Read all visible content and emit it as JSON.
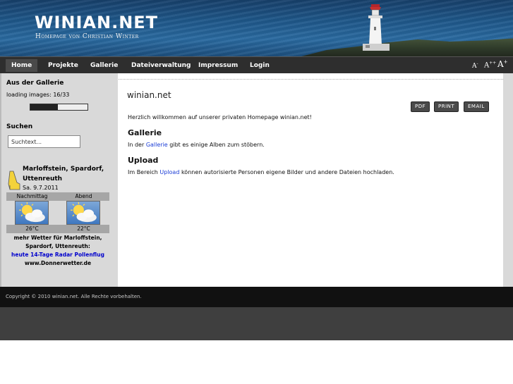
{
  "site": {
    "title": "WINIAN.NET",
    "subtitle": "Homepage von Christian Winter"
  },
  "nav": {
    "items": [
      "Home",
      "Projekte",
      "Gallerie",
      "Dateiverwaltung",
      "Impressum",
      "Login"
    ],
    "active": "Home",
    "font_size_controls": [
      "A-",
      "A+",
      "A+"
    ]
  },
  "sidebar": {
    "gallery": {
      "heading": "Aus der Gallerie",
      "loading_text": "loading images: 16/33",
      "progress": 0.48
    },
    "search": {
      "heading": "Suchen",
      "placeholder": "Suchtext..."
    },
    "weather": {
      "place": "Marloffstein, Spardorf, Uttenreuth",
      "date": "Sa. 9.7.2011",
      "periods": [
        "Nachmittag",
        "Abend"
      ],
      "temps": [
        "26°C",
        "22°C"
      ],
      "icon": "sun-cloud-icon",
      "more_line1": "mehr Wetter für Marloffstein,",
      "more_line2": "Spardorf, Uttenreuth:",
      "links": [
        "heute",
        "14-Tage",
        "Radar",
        "Pollenflug"
      ],
      "source": "www.Donnerwetter.de"
    }
  },
  "main": {
    "title": "winian.net",
    "buttons": [
      "PDF",
      "PRINT",
      "EMAIL"
    ],
    "intro": "Herzlich willkommen auf unserer privaten Homepage winian.net!",
    "sections": [
      {
        "heading": "Gallerie",
        "text_before": "In der ",
        "link": "Gallerie",
        "text_after": " gibt es einige Alben zum stöbern."
      },
      {
        "heading": "Upload",
        "text_before": "Im Bereich ",
        "link": "Upload",
        "text_after": " können autorisierte Personen eigene Bilder und andere Dateien hochladen."
      }
    ]
  },
  "footer": {
    "copyright": "Copyright © 2010 winian.net. Alle Rechte vorbehalten."
  },
  "colors": {
    "navbar": "#2e2e2e",
    "sidebar": "#d9d9d9",
    "link": "#1a3cd6",
    "footer": "#111111"
  }
}
